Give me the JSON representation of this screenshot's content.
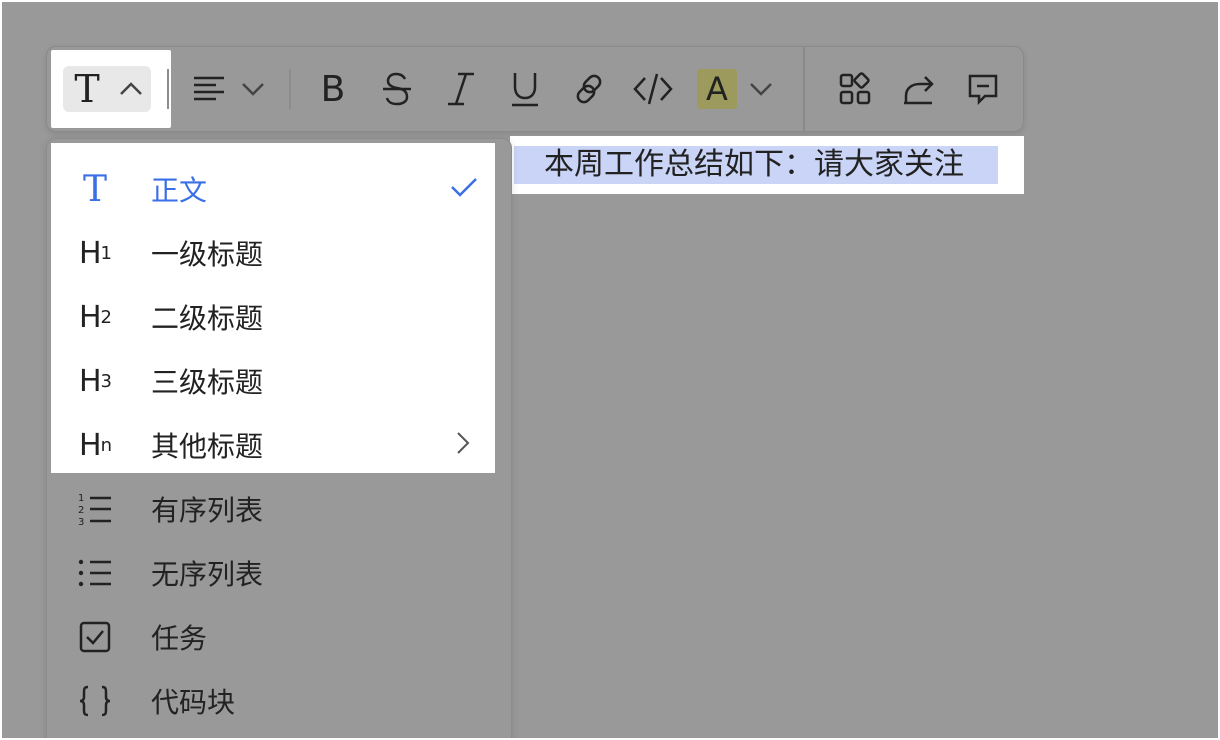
{
  "toolbar": {
    "text_style_icon": "T",
    "highlight_letter": "A",
    "buttons": [
      "text-style",
      "align",
      "bold",
      "strikethrough",
      "italic",
      "underline",
      "link",
      "code",
      "highlight",
      "blocks",
      "share",
      "comment"
    ],
    "bold_glyph": "B",
    "italic_glyph": "I"
  },
  "document": {
    "selected_text": "本周工作总结如下：请大家关注"
  },
  "menu": {
    "items": [
      {
        "label": "正文",
        "icon": "T",
        "active": true
      },
      {
        "label": "一级标题",
        "icon": "H",
        "sub": "1"
      },
      {
        "label": "二级标题",
        "icon": "H",
        "sub": "2"
      },
      {
        "label": "三级标题",
        "icon": "H",
        "sub": "3"
      },
      {
        "label": "其他标题",
        "icon": "H",
        "sub": "n"
      },
      {
        "label": "有序列表"
      },
      {
        "label": "无序列表"
      },
      {
        "label": "任务"
      },
      {
        "label": "代码块"
      }
    ]
  },
  "colors": {
    "accent": "#3a6fe6",
    "overlay": "#999999",
    "selection": "#c9d4f6",
    "highlight_bg": "#9c9a5c"
  }
}
